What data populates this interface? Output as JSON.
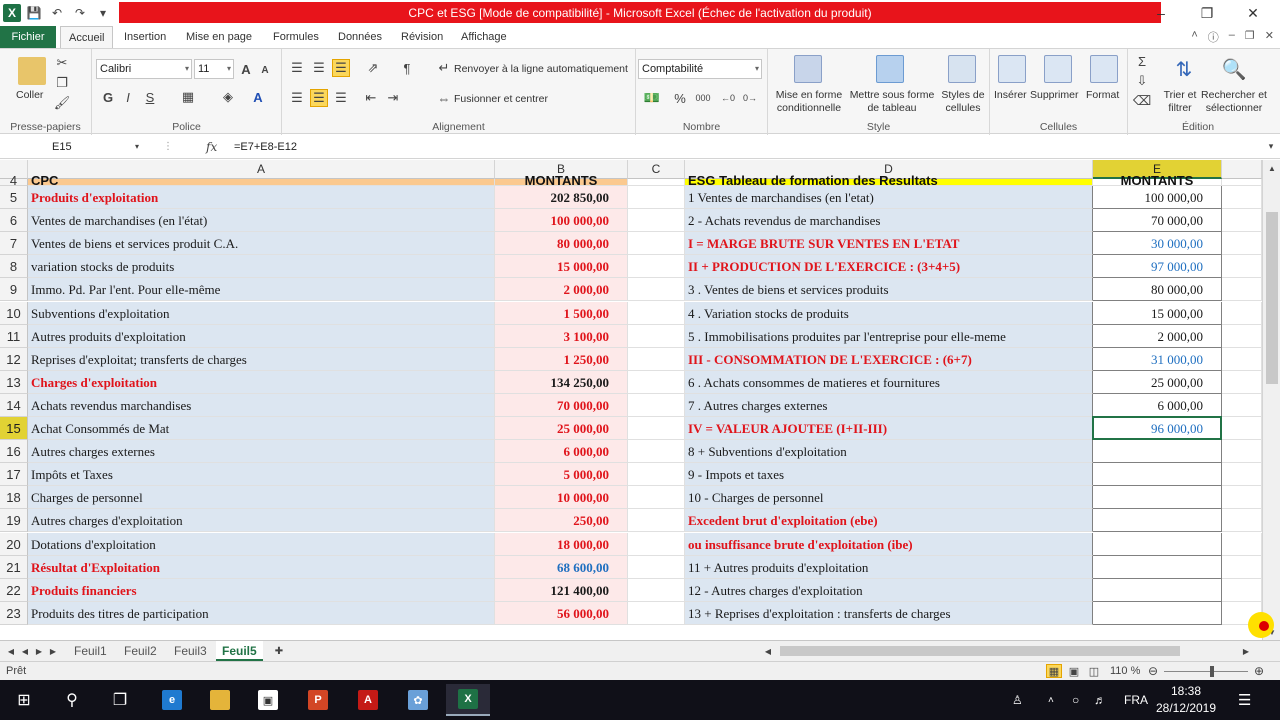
{
  "window": {
    "title": "CPC et ESG  [Mode de compatibilité]  -  Microsoft Excel (Échec de l'activation du produit)",
    "logo": "X"
  },
  "tabs": [
    "Fichier",
    "Accueil",
    "Insertion",
    "Mise en page",
    "Formules",
    "Données",
    "Révision",
    "Affichage"
  ],
  "ribbon": {
    "clipboard": {
      "paste": "Coller",
      "label": "Presse-papiers"
    },
    "font": {
      "name": "Calibri",
      "size": "11",
      "label": "Police"
    },
    "alignment": {
      "wrap": "Renvoyer à la ligne automatiquement",
      "merge": "Fusionner et centrer",
      "label": "Alignement"
    },
    "number": {
      "format": "Comptabilité",
      "label": "Nombre"
    },
    "styles": {
      "cond": "Mise en forme conditionnelle",
      "table": "Mettre sous forme de tableau",
      "cell": "Styles de cellules",
      "label": "Style"
    },
    "cells": {
      "insert": "Insérer",
      "delete": "Supprimer",
      "format": "Format",
      "label": "Cellules"
    },
    "editing": {
      "sort": "Trier et filtrer",
      "find": "Rechercher et sélectionner",
      "label": "Édition"
    }
  },
  "formula_bar": {
    "cell": "E15",
    "fx": "fx",
    "formula": "=E7+E8-E12"
  },
  "columns": [
    "A",
    "B",
    "C",
    "D",
    "E"
  ],
  "rows": [
    {
      "n": "4",
      "a": "CPC",
      "b": "MONTANTS",
      "d": "ESG Tableau de formation des Resultats",
      "e": "MONTANTS"
    },
    {
      "n": "5",
      "a": "Produits d'exploitation",
      "b": "202 850,00",
      "d": "1 Ventes de marchandises (en l'etat)",
      "e": "100 000,00"
    },
    {
      "n": "6",
      "a": "Ventes de marchandises (en l'état)",
      "b": "100 000,00",
      "d": "2 - Achats revendus de marchandises",
      "e": "70 000,00"
    },
    {
      "n": "7",
      "a": "Ventes de biens et services produit C.A.",
      "b": "80 000,00",
      "d": "I = MARGE BRUTE SUR VENTES EN L'ETAT",
      "e": "30 000,00"
    },
    {
      "n": "8",
      "a": "variation stocks de produits",
      "b": "15 000,00",
      "d": "II + PRODUCTION DE L'EXERCICE : (3+4+5)",
      "e": "97 000,00"
    },
    {
      "n": "9",
      "a": "Immo. Pd. Par l'ent. Pour elle-même",
      "b": "2 000,00",
      "d": "3 . Ventes de biens et services produits",
      "e": "80 000,00"
    },
    {
      "n": "10",
      "a": "Subventions d'exploitation",
      "b": "1 500,00",
      "d": "4 . Variation stocks de produits",
      "e": "15 000,00"
    },
    {
      "n": "11",
      "a": "Autres produits d'exploitation",
      "b": "3 100,00",
      "d": "5 . Immobilisations produites par l'entreprise pour elle-meme",
      "e": "2 000,00"
    },
    {
      "n": "12",
      "a": "Reprises d'exploitat; transferts de charges",
      "b": "1 250,00",
      "d": "III - CONSOMMATION DE L'EXERCICE : (6+7)",
      "e": "31 000,00"
    },
    {
      "n": "13",
      "a": "Charges d'exploitation",
      "b": "134 250,00",
      "d": "6 . Achats consommes de matieres et fournitures",
      "e": "25 000,00"
    },
    {
      "n": "14",
      "a": "Achats revendus marchandises",
      "b": "70 000,00",
      "d": "7 . Autres charges externes",
      "e": "6 000,00"
    },
    {
      "n": "15",
      "a": "Achat Consommés de Mat",
      "b": "25 000,00",
      "d": "IV = VALEUR AJOUTEE (I+II-III)",
      "e": "96 000,00"
    },
    {
      "n": "16",
      "a": "Autres charges externes",
      "b": "6 000,00",
      "d": "8 + Subventions d'exploitation",
      "e": ""
    },
    {
      "n": "17",
      "a": "Impôts et Taxes",
      "b": "5 000,00",
      "d": "9 - Impots et taxes",
      "e": ""
    },
    {
      "n": "18",
      "a": "Charges de personnel",
      "b": "10 000,00",
      "d": "10 - Charges de personnel",
      "e": ""
    },
    {
      "n": "19",
      "a": "Autres charges d'exploitation",
      "b": "250,00",
      "d": "Excedent brut d'exploitation (ebe)",
      "e": ""
    },
    {
      "n": "20",
      "a": "Dotations d'exploitation",
      "b": "18 000,00",
      "d": "ou insuffisance brute d'exploitation (ibe)",
      "e": ""
    },
    {
      "n": "21",
      "a": "Résultat d'Exploitation",
      "b": "68 600,00",
      "d": "11 + Autres produits d'exploitation",
      "e": ""
    },
    {
      "n": "22",
      "a": "Produits financiers",
      "b": "121 400,00",
      "d": "12 - Autres charges d'exploitation",
      "e": ""
    },
    {
      "n": "23",
      "a": "Produits des titres de participation",
      "b": "56 000,00",
      "d": "13 + Reprises d'exploitation : transferts de charges",
      "e": ""
    }
  ],
  "sheets": [
    "Feuil1",
    "Feuil2",
    "Feuil3",
    "Feuil5"
  ],
  "active_sheet": "Feuil5",
  "status": {
    "ready": "Prêt",
    "zoom": "110 %"
  },
  "taskbar": {
    "lang": "FRA",
    "time": "18:38",
    "date": "28/12/2019"
  }
}
